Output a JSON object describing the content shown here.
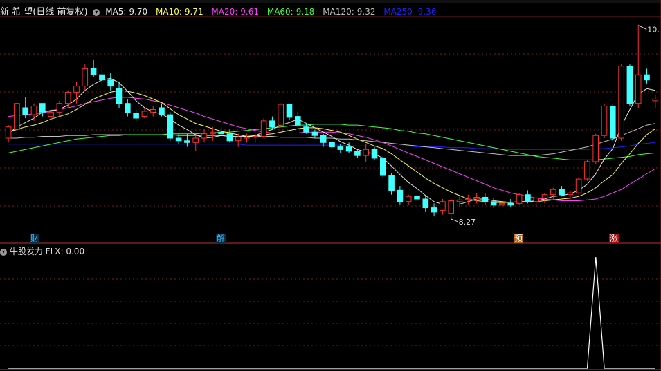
{
  "header": {
    "title": "新 希 望(日线 前复权)",
    "indicators": [
      {
        "label": "MA5:",
        "value": "9.70",
        "color": "#e8e8e8"
      },
      {
        "label": "MA10:",
        "value": "9.71",
        "color": "#ffff40"
      },
      {
        "label": "MA20:",
        "value": "9.61",
        "color": "#ff40ff"
      },
      {
        "label": "MA60:",
        "value": "9.18",
        "color": "#40ff40"
      },
      {
        "label": "MA120:",
        "value": "9.32",
        "color": "#c0c0c0"
      },
      {
        "label": "MA250",
        "value": "9.36",
        "color": "#2020ff"
      }
    ]
  },
  "sub_panel": {
    "name": "牛股发力",
    "indicator_label": "FLX:",
    "indicator_value": "0.00"
  },
  "event_marks": [
    {
      "text": "财",
      "color": "#40c0ff"
    },
    {
      "text": "解",
      "color": "#40c0ff"
    },
    {
      "text": "预",
      "color": "#ff9030"
    },
    {
      "text": "涨",
      "color": "#ff4040"
    }
  ],
  "chart_data": {
    "type": "candlestick",
    "ylim": [
      8.1,
      10.55
    ],
    "annotations": {
      "high": "10.",
      "low": "8.27"
    },
    "colors": {
      "up": "#ff3030",
      "down": "#40ffff",
      "ma5": "#e8e8e8",
      "ma10": "#ffff40",
      "ma20": "#ff40ff",
      "ma60": "#40ff40",
      "ma120": "#c0c0c0",
      "ma250": "#2020ff"
    },
    "candles": [
      [
        9.15,
        9.3,
        9.1,
        9.28
      ],
      [
        9.25,
        9.6,
        9.2,
        9.55
      ],
      [
        9.5,
        9.62,
        9.38,
        9.42
      ],
      [
        9.42,
        9.55,
        9.35,
        9.52
      ],
      [
        9.55,
        9.55,
        9.4,
        9.45
      ],
      [
        9.4,
        9.5,
        9.35,
        9.45
      ],
      [
        9.45,
        9.58,
        9.4,
        9.55
      ],
      [
        9.55,
        9.7,
        9.5,
        9.68
      ],
      [
        9.68,
        9.8,
        9.55,
        9.75
      ],
      [
        9.75,
        10.0,
        9.7,
        9.95
      ],
      [
        9.95,
        10.05,
        9.85,
        9.88
      ],
      [
        9.88,
        10.0,
        9.78,
        9.82
      ],
      [
        9.82,
        9.9,
        9.7,
        9.75
      ],
      [
        9.72,
        9.8,
        9.5,
        9.55
      ],
      [
        9.55,
        9.6,
        9.4,
        9.44
      ],
      [
        9.44,
        9.48,
        9.35,
        9.38
      ],
      [
        9.4,
        9.5,
        9.38,
        9.46
      ],
      [
        9.45,
        9.52,
        9.4,
        9.48
      ],
      [
        9.5,
        9.55,
        9.4,
        9.42
      ],
      [
        9.42,
        9.45,
        9.12,
        9.15
      ],
      [
        9.15,
        9.2,
        9.08,
        9.12
      ],
      [
        9.12,
        9.2,
        9.05,
        9.1
      ],
      [
        9.1,
        9.18,
        9.0,
        9.15
      ],
      [
        9.15,
        9.25,
        9.1,
        9.2
      ],
      [
        9.2,
        9.28,
        9.12,
        9.22
      ],
      [
        9.22,
        9.28,
        9.18,
        9.2
      ],
      [
        9.2,
        9.25,
        9.1,
        9.12
      ],
      [
        9.12,
        9.2,
        9.05,
        9.16
      ],
      [
        9.15,
        9.2,
        9.1,
        9.16
      ],
      [
        9.16,
        9.2,
        9.1,
        9.17
      ],
      [
        9.17,
        9.38,
        9.15,
        9.35
      ],
      [
        9.35,
        9.4,
        9.25,
        9.28
      ],
      [
        9.3,
        9.55,
        9.28,
        9.54
      ],
      [
        9.54,
        9.55,
        9.36,
        9.39
      ],
      [
        9.4,
        9.45,
        9.28,
        9.3
      ],
      [
        9.28,
        9.32,
        9.2,
        9.22
      ],
      [
        9.22,
        9.25,
        9.15,
        9.18
      ],
      [
        9.18,
        9.2,
        9.05,
        9.1
      ],
      [
        9.1,
        9.12,
        9.0,
        9.05
      ],
      [
        9.05,
        9.08,
        8.98,
        9.02
      ],
      [
        9.05,
        9.1,
        8.98,
        9.0
      ],
      [
        9.0,
        9.02,
        8.92,
        8.95
      ],
      [
        8.95,
        9.08,
        8.88,
        9.02
      ],
      [
        9.02,
        9.05,
        8.9,
        8.92
      ],
      [
        8.92,
        8.94,
        8.7,
        8.72
      ],
      [
        8.72,
        8.75,
        8.5,
        8.55
      ],
      [
        8.55,
        8.6,
        8.38,
        8.42
      ],
      [
        8.42,
        8.5,
        8.38,
        8.48
      ],
      [
        8.48,
        8.52,
        8.42,
        8.45
      ],
      [
        8.45,
        8.5,
        8.3,
        8.35
      ],
      [
        8.35,
        8.4,
        8.25,
        8.3
      ],
      [
        8.32,
        8.45,
        8.27,
        8.42
      ],
      [
        8.28,
        8.45,
        8.22,
        8.43
      ],
      [
        8.42,
        8.48,
        8.36,
        8.44
      ],
      [
        8.44,
        8.5,
        8.38,
        8.45
      ],
      [
        8.45,
        8.52,
        8.4,
        8.47
      ],
      [
        8.47,
        8.52,
        8.38,
        8.42
      ],
      [
        8.42,
        8.46,
        8.35,
        8.38
      ],
      [
        8.38,
        8.42,
        8.34,
        8.4
      ],
      [
        8.4,
        8.45,
        8.36,
        8.38
      ],
      [
        8.4,
        8.52,
        8.38,
        8.5
      ],
      [
        8.5,
        8.55,
        8.4,
        8.42
      ],
      [
        8.42,
        8.48,
        8.35,
        8.46
      ],
      [
        8.46,
        8.52,
        8.4,
        8.5
      ],
      [
        8.5,
        8.58,
        8.44,
        8.56
      ],
      [
        8.56,
        8.6,
        8.48,
        8.5
      ],
      [
        8.5,
        8.55,
        8.44,
        8.52
      ],
      [
        8.52,
        8.7,
        8.5,
        8.68
      ],
      [
        8.68,
        8.9,
        8.66,
        8.88
      ],
      [
        8.88,
        9.2,
        8.85,
        9.18
      ],
      [
        9.18,
        9.55,
        9.15,
        9.52
      ],
      [
        9.52,
        9.55,
        9.1,
        9.15
      ],
      [
        9.15,
        10.0,
        9.12,
        9.98
      ],
      [
        9.98,
        10.0,
        9.52,
        9.55
      ],
      [
        9.55,
        10.45,
        9.5,
        9.88
      ],
      [
        9.88,
        9.95,
        9.78,
        9.82
      ],
      [
        9.58,
        9.65,
        9.5,
        9.6
      ]
    ],
    "ma5": [
      9.2,
      9.28,
      9.33,
      9.38,
      9.45,
      9.47,
      9.48,
      9.53,
      9.6,
      9.7,
      9.77,
      9.82,
      9.84,
      9.79,
      9.69,
      9.58,
      9.5,
      9.45,
      9.43,
      9.37,
      9.3,
      9.25,
      9.19,
      9.15,
      9.16,
      9.18,
      9.17,
      9.16,
      9.17,
      9.18,
      9.22,
      9.25,
      9.3,
      9.33,
      9.37,
      9.32,
      9.27,
      9.22,
      9.17,
      9.11,
      9.07,
      9.02,
      8.99,
      8.97,
      8.92,
      8.83,
      8.73,
      8.64,
      8.57,
      8.49,
      8.42,
      8.39,
      8.39,
      8.39,
      8.42,
      8.45,
      8.45,
      8.43,
      8.42,
      8.41,
      8.42,
      8.42,
      8.43,
      8.45,
      8.48,
      8.49,
      8.51,
      8.55,
      8.62,
      8.74,
      8.91,
      9.03,
      9.29,
      9.48,
      9.66,
      9.72,
      9.7
    ],
    "ma10": [
      9.22,
      9.25,
      9.28,
      9.3,
      9.33,
      9.37,
      9.4,
      9.43,
      9.48,
      9.54,
      9.6,
      9.64,
      9.68,
      9.7,
      9.69,
      9.67,
      9.64,
      9.6,
      9.56,
      9.49,
      9.42,
      9.37,
      9.32,
      9.29,
      9.26,
      9.23,
      9.21,
      9.19,
      9.17,
      9.17,
      9.19,
      9.2,
      9.22,
      9.24,
      9.26,
      9.27,
      9.27,
      9.26,
      9.24,
      9.22,
      9.18,
      9.14,
      9.1,
      9.06,
      9.03,
      8.97,
      8.9,
      8.83,
      8.76,
      8.69,
      8.63,
      8.58,
      8.53,
      8.49,
      8.45,
      8.43,
      8.42,
      8.41,
      8.41,
      8.41,
      8.42,
      8.42,
      8.42,
      8.43,
      8.44,
      8.45,
      8.46,
      8.48,
      8.52,
      8.58,
      8.66,
      8.73,
      8.86,
      8.97,
      9.09,
      9.19,
      9.26
    ],
    "ma20": [
      9.4,
      9.41,
      9.42,
      9.43,
      9.44,
      9.46,
      9.48,
      9.5,
      9.52,
      9.55,
      9.57,
      9.59,
      9.61,
      9.62,
      9.62,
      9.61,
      9.6,
      9.58,
      9.56,
      9.53,
      9.5,
      9.47,
      9.44,
      9.4,
      9.37,
      9.34,
      9.31,
      9.28,
      9.26,
      9.24,
      9.22,
      9.21,
      9.21,
      9.21,
      9.21,
      9.22,
      9.22,
      9.22,
      9.22,
      9.21,
      9.2,
      9.18,
      9.16,
      9.13,
      9.1,
      9.06,
      9.02,
      8.98,
      8.94,
      8.9,
      8.86,
      8.82,
      8.78,
      8.74,
      8.7,
      8.66,
      8.62,
      8.58,
      8.55,
      8.52,
      8.5,
      8.48,
      8.46,
      8.45,
      8.44,
      8.43,
      8.43,
      8.43,
      8.44,
      8.45,
      8.48,
      8.52,
      8.56,
      8.62,
      8.68,
      8.74,
      8.8
    ],
    "ma60": [
      8.98,
      9.0,
      9.02,
      9.04,
      9.06,
      9.08,
      9.1,
      9.12,
      9.14,
      9.15,
      9.16,
      9.17,
      9.18,
      9.18,
      9.19,
      9.19,
      9.19,
      9.19,
      9.19,
      9.2,
      9.2,
      9.2,
      9.2,
      9.21,
      9.21,
      9.22,
      9.22,
      9.23,
      9.24,
      9.25,
      9.26,
      9.27,
      9.28,
      9.29,
      9.3,
      9.3,
      9.31,
      9.31,
      9.31,
      9.31,
      9.3,
      9.3,
      9.29,
      9.28,
      9.27,
      9.26,
      9.24,
      9.23,
      9.21,
      9.2,
      9.18,
      9.16,
      9.14,
      9.12,
      9.1,
      9.08,
      9.06,
      9.04,
      9.02,
      9.0,
      8.98,
      8.96,
      8.94,
      8.93,
      8.92,
      8.91,
      8.9,
      8.9,
      8.9,
      8.9,
      8.91,
      8.92,
      8.93,
      8.94,
      8.96,
      8.97,
      8.98
    ],
    "ma120": [
      9.15,
      9.15,
      9.16,
      9.16,
      9.17,
      9.17,
      9.17,
      9.18,
      9.18,
      9.18,
      9.19,
      9.19,
      9.19,
      9.19,
      9.19,
      9.19,
      9.19,
      9.19,
      9.19,
      9.19,
      9.18,
      9.18,
      9.18,
      9.18,
      9.18,
      9.18,
      9.17,
      9.17,
      9.17,
      9.17,
      9.17,
      9.17,
      9.16,
      9.16,
      9.16,
      9.16,
      9.15,
      9.15,
      9.15,
      9.14,
      9.14,
      9.13,
      9.12,
      9.11,
      9.1,
      9.09,
      9.08,
      9.07,
      9.06,
      9.05,
      9.04,
      9.03,
      9.02,
      9.01,
      9.0,
      8.99,
      8.98,
      8.97,
      8.96,
      8.95,
      8.95,
      8.95,
      8.95,
      8.96,
      8.97,
      8.99,
      9.01,
      9.03,
      9.05,
      9.08,
      9.11,
      9.14,
      9.18,
      9.22,
      9.26,
      9.3,
      9.32
    ],
    "ma250": [
      9.08,
      9.08,
      9.08,
      9.08,
      9.08,
      9.08,
      9.08,
      9.08,
      9.08,
      9.08,
      9.08,
      9.08,
      9.08,
      9.08,
      9.08,
      9.08,
      9.08,
      9.08,
      9.08,
      9.08,
      9.08,
      9.08,
      9.08,
      9.08,
      9.08,
      9.08,
      9.08,
      9.08,
      9.07,
      9.07,
      9.07,
      9.07,
      9.07,
      9.07,
      9.07,
      9.07,
      9.07,
      9.07,
      9.07,
      9.07,
      9.06,
      9.06,
      9.06,
      9.06,
      9.06,
      9.06,
      9.06,
      9.06,
      9.05,
      9.05,
      9.05,
      9.05,
      9.04,
      9.04,
      9.04,
      9.03,
      9.03,
      9.03,
      9.02,
      9.02,
      9.02,
      9.02,
      9.02,
      9.02,
      9.02,
      9.02,
      9.02,
      9.02,
      9.02,
      9.03,
      9.03,
      9.04,
      9.05,
      9.06,
      9.08,
      9.09,
      9.1
    ],
    "flx": [
      0,
      0,
      0,
      0,
      0,
      0,
      0,
      0,
      0,
      0,
      0,
      0,
      0,
      0,
      0,
      0,
      0,
      0,
      0,
      0,
      0,
      0,
      0,
      0,
      0,
      0,
      0,
      0,
      0,
      0,
      0,
      0,
      0,
      0,
      0,
      0,
      0,
      0,
      0,
      0,
      0,
      0,
      0,
      0,
      0,
      0,
      0,
      0,
      0,
      0,
      0,
      0,
      0,
      0,
      0,
      0,
      0,
      0,
      0,
      0,
      0,
      0,
      0,
      0,
      0,
      0,
      0,
      0,
      0,
      1,
      0,
      0,
      0,
      0,
      0,
      0,
      0
    ]
  }
}
